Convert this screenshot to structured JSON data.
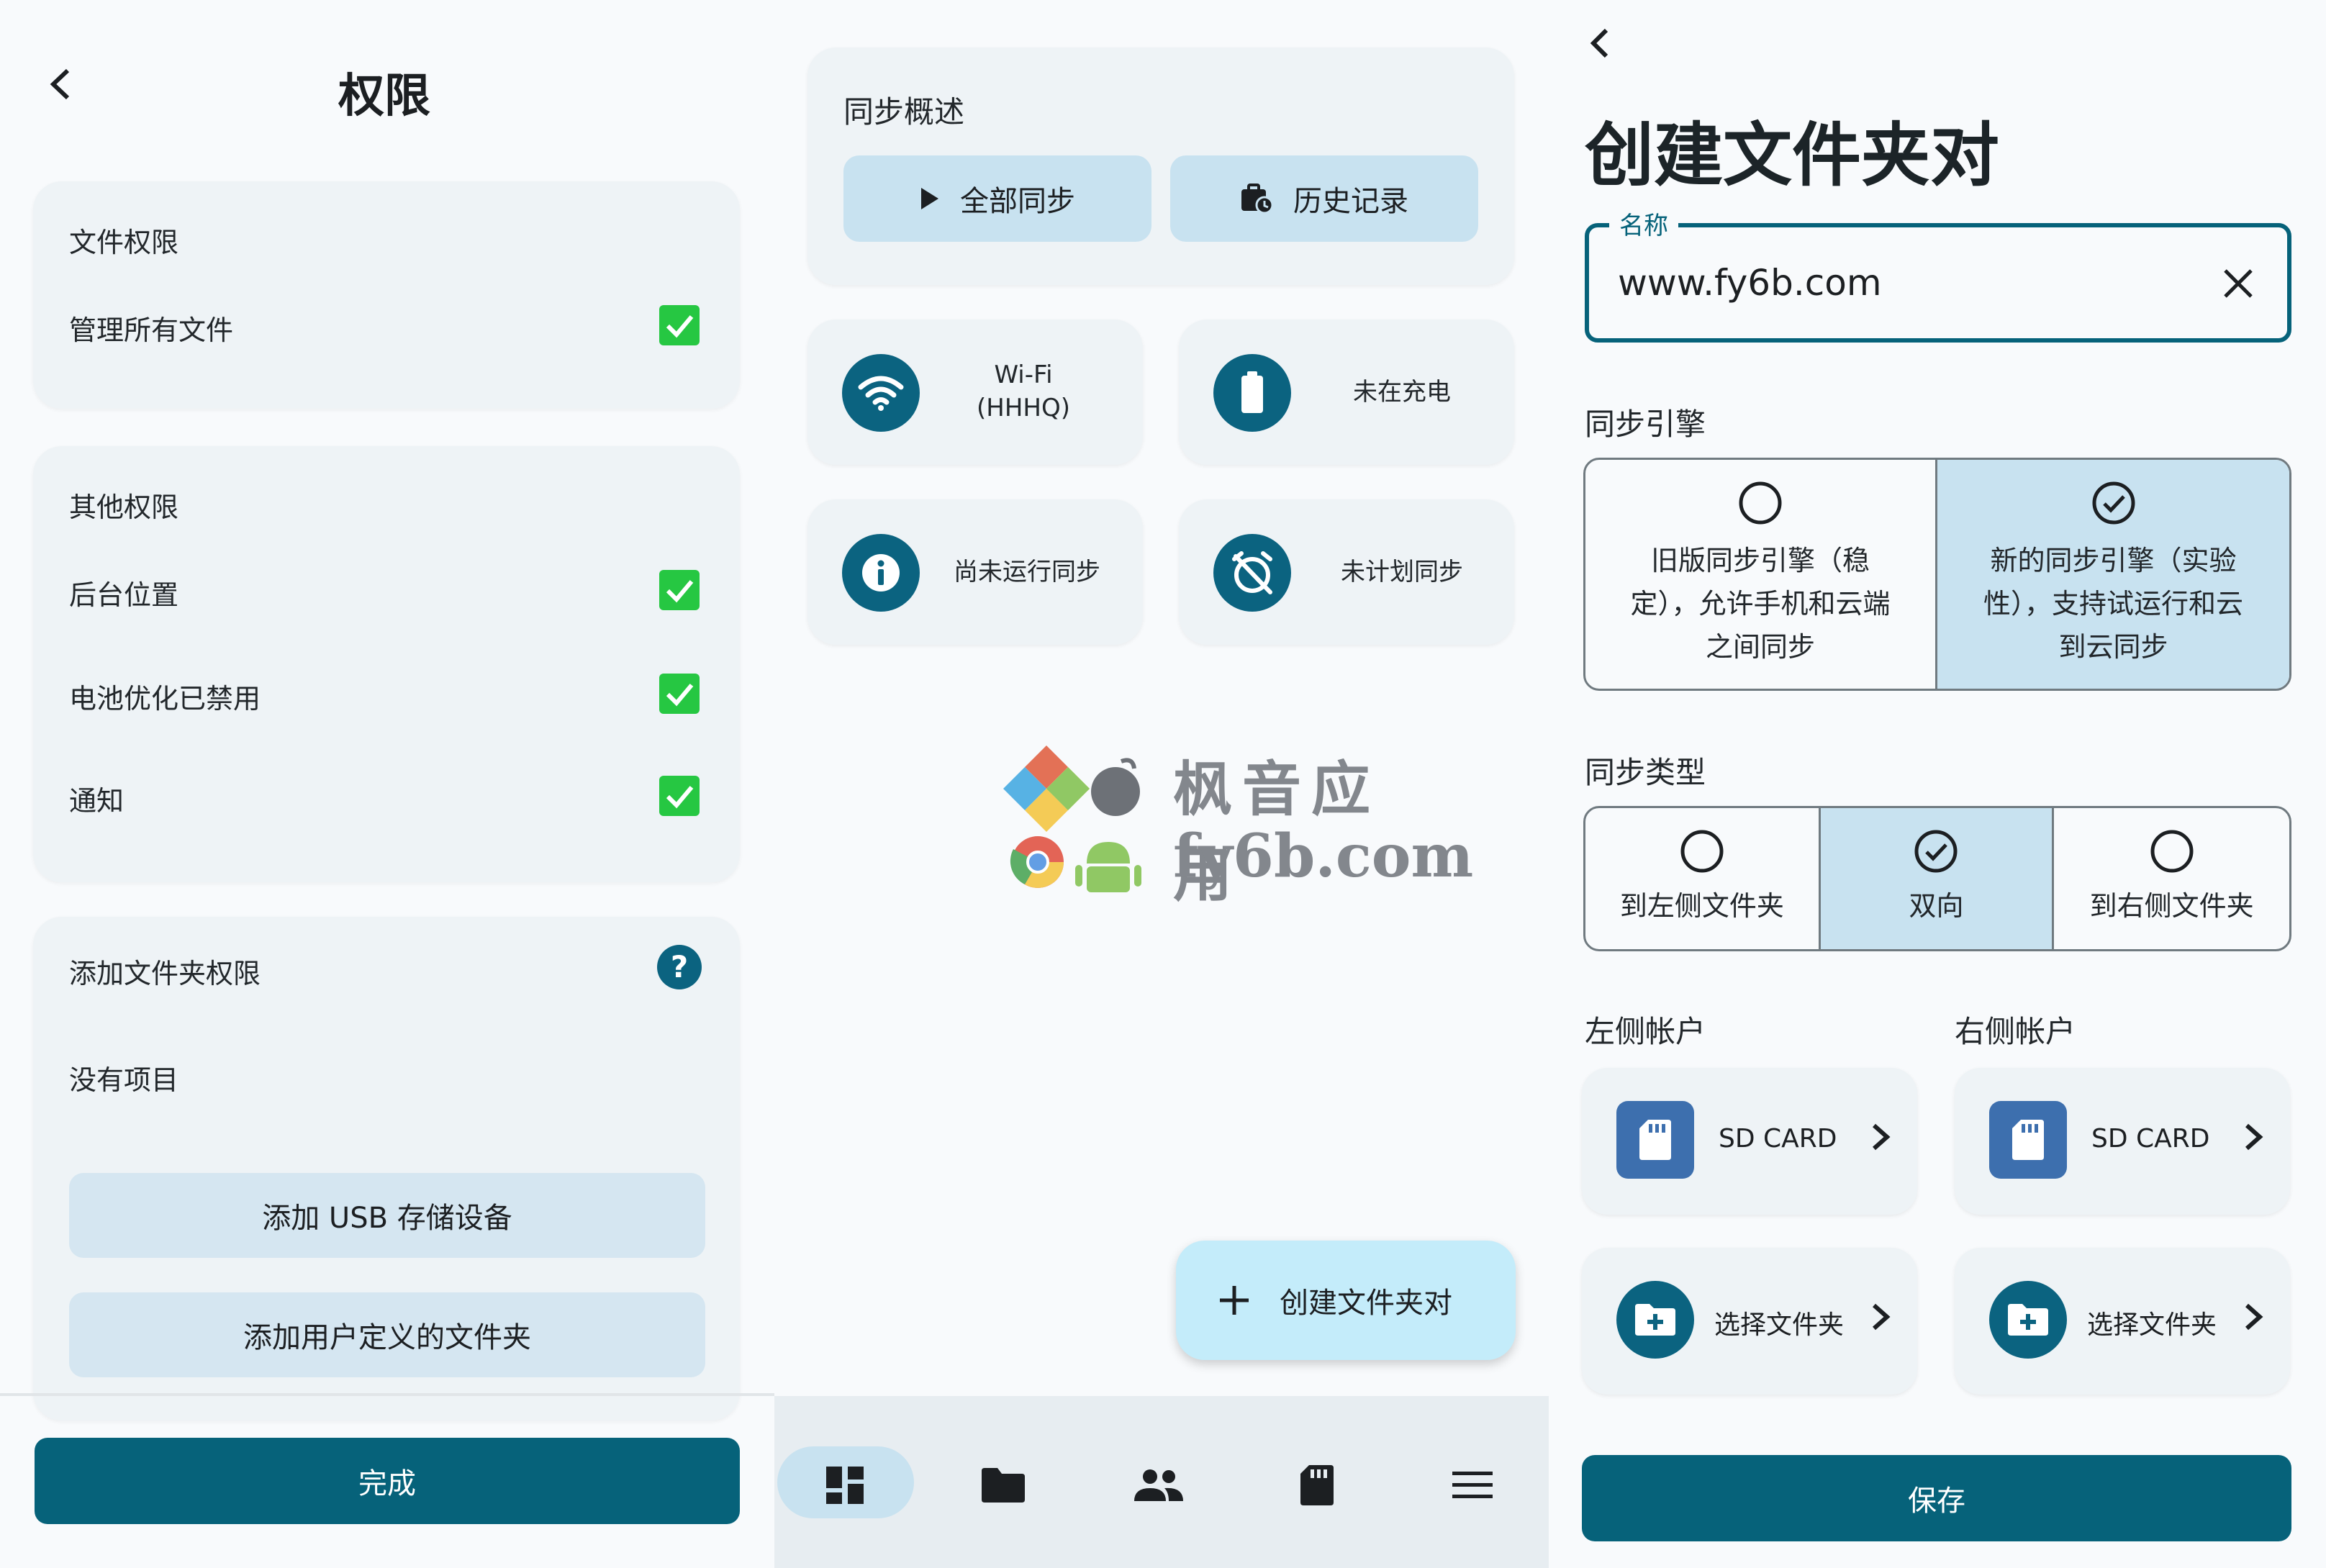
{
  "permissions": {
    "title": "权限",
    "file_permissions": {
      "heading": "文件权限",
      "items": [
        {
          "label": "管理所有文件",
          "checked": true
        }
      ]
    },
    "other_permissions": {
      "heading": "其他权限",
      "items": [
        {
          "label": "后台位置",
          "checked": true
        },
        {
          "label": "电池优化已禁用",
          "checked": true
        },
        {
          "label": "通知",
          "checked": true
        }
      ]
    },
    "folder_permissions": {
      "heading": "添加文件夹权限",
      "empty_text": "没有项目",
      "add_usb_label": "添加 USB 存储设备",
      "add_user_folder_label": "添加用户定义的文件夹"
    },
    "done_label": "完成"
  },
  "dashboard": {
    "sync_overview": {
      "heading": "同步概述",
      "sync_all_label": "全部同步",
      "history_label": "历史记录"
    },
    "status": {
      "wifi_line1": "Wi-Fi",
      "wifi_line2": "(HHHQ)",
      "charging": "未在充电",
      "last_run": "尚未运行同步",
      "schedule": "未计划同步"
    },
    "fab_label": "创建文件夹对",
    "nav": [
      "dashboard",
      "folders",
      "accounts",
      "storage",
      "menu"
    ],
    "watermark_line1": "枫音应用",
    "watermark_line2": "fy6b.com"
  },
  "create_pair": {
    "title": "创建文件夹对",
    "name_label": "名称",
    "name_value": "www.fy6b.com",
    "engine": {
      "heading": "同步引擎",
      "options": [
        {
          "label": "旧版同步引擎（稳定），允许手机和云端之间同步",
          "line1": "旧版同步引擎（稳",
          "line2": "定），允许手机和云端",
          "line3": "之间同步",
          "selected": false
        },
        {
          "label": "新的同步引擎（实验性），支持试运行和云到云同步",
          "line1": "新的同步引擎（实验",
          "line2": "性），支持试运行和云",
          "line3": "到云同步",
          "selected": true
        }
      ]
    },
    "sync_type": {
      "heading": "同步类型",
      "options": [
        {
          "label": "到左侧文件夹",
          "selected": false
        },
        {
          "label": "双向",
          "selected": true
        },
        {
          "label": "到右侧文件夹",
          "selected": false
        }
      ]
    },
    "left_account": {
      "heading": "左侧帐户",
      "storage": "SD CARD",
      "folder": "选择文件夹"
    },
    "right_account": {
      "heading": "右侧帐户",
      "storage": "SD CARD",
      "folder": "选择文件夹"
    },
    "save_label": "保存"
  },
  "colors": {
    "primary": "#06627a",
    "tonal": "#c8e2f0",
    "check": "#26c742",
    "card": "#eef3f6"
  }
}
